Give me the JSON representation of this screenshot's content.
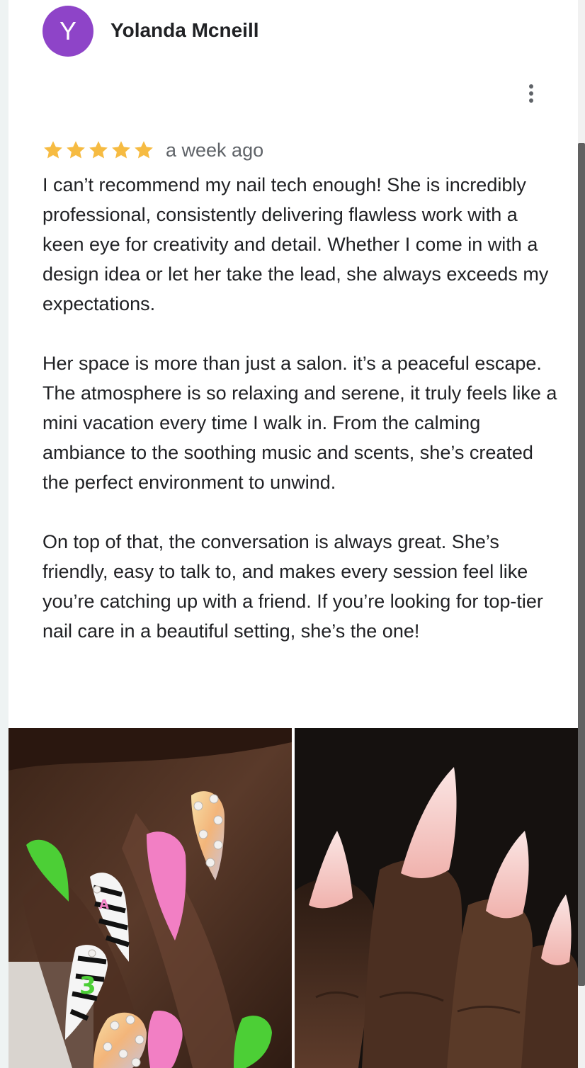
{
  "review": {
    "author_initial": "Y",
    "author_name": "Yolanda Mcneill",
    "rating": 5,
    "rating_max": 5,
    "date": "a week ago",
    "paragraphs": [
      "I can’t recommend my nail tech enough! She is incredibly professional, consistently delivering flawless work with a keen eye for creativity and detail. Whether I come in with a design idea or let her take the lead, she always exceeds my expectations.",
      "Her space is more than just a salon. it’s a peaceful escape. The atmosphere is so relaxing and serene, it truly feels like a mini vacation every time I walk in. From the calming ambiance to the soothing music and scents, she’s created the perfect environment to unwind.",
      "On top of that, the conversation is always great. She’s friendly, easy to talk to, and makes every session feel like you’re catching up with a friend. If you’re looking for top-tier nail care in a beautiful setting, she’s the one!"
    ]
  },
  "icons": {
    "more": "more-vert-icon",
    "star": "star-icon"
  },
  "colors": {
    "avatar": "#8e44c8",
    "star": "#f6bb42",
    "text": "#202124",
    "secondary": "#5f6368",
    "nail_pink": "#f27fc4",
    "nail_green": "#4ccf36",
    "nail_nude": "#f4c2c0"
  }
}
